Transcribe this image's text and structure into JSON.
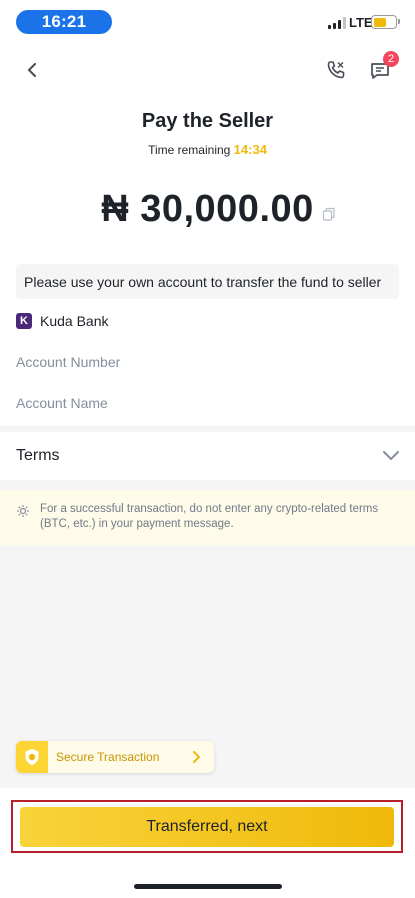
{
  "status_bar": {
    "time": "16:21",
    "network": "LTE"
  },
  "header": {
    "chat_badge_count": "2"
  },
  "page": {
    "title": "Pay the Seller",
    "time_remaining_label": "Time remaining",
    "countdown": "14:34",
    "amount": "₦ 30,000.00"
  },
  "notice": "Please use your own account to transfer the fund to seller",
  "payment_method": {
    "bank_logo_letter": "K",
    "bank_name": "Kuda Bank"
  },
  "fields": {
    "account_number_label": "Account Number",
    "account_name_label": "Account Name"
  },
  "terms": {
    "label": "Terms"
  },
  "tip": "For a successful transaction, do not enter any crypto-related terms (BTC, etc.) in your payment message.",
  "secure": {
    "label": "Secure Transaction"
  },
  "actions": {
    "primary_label": "Transferred, next"
  },
  "colors": {
    "accent": "#f0b90b",
    "badge": "#f6465d",
    "time_pill": "#1a73e8",
    "bank_brand": "#4b2879"
  },
  "icons": [
    "back-icon",
    "phone-icon",
    "chat-icon",
    "copy-icon",
    "chevron-down-icon",
    "bulb-icon",
    "shield-icon",
    "chevron-right-icon"
  ]
}
